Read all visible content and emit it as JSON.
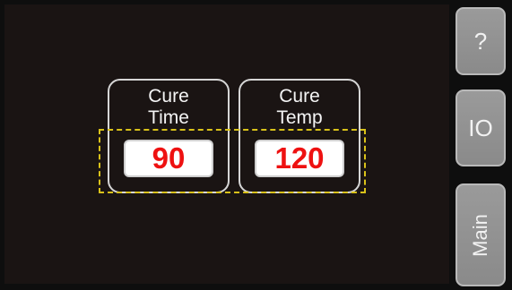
{
  "params": [
    {
      "label_line1": "Cure",
      "label_line2": "Time",
      "value": "90"
    },
    {
      "label_line1": "Cure",
      "label_line2": "Temp",
      "value": "120"
    }
  ],
  "side_buttons": {
    "help": "?",
    "io": "IO",
    "main": "Main"
  },
  "colors": {
    "background": "#1a1413",
    "value_text": "#ee1111",
    "highlight": "#d9c21a",
    "button": "#8f8f8f"
  }
}
